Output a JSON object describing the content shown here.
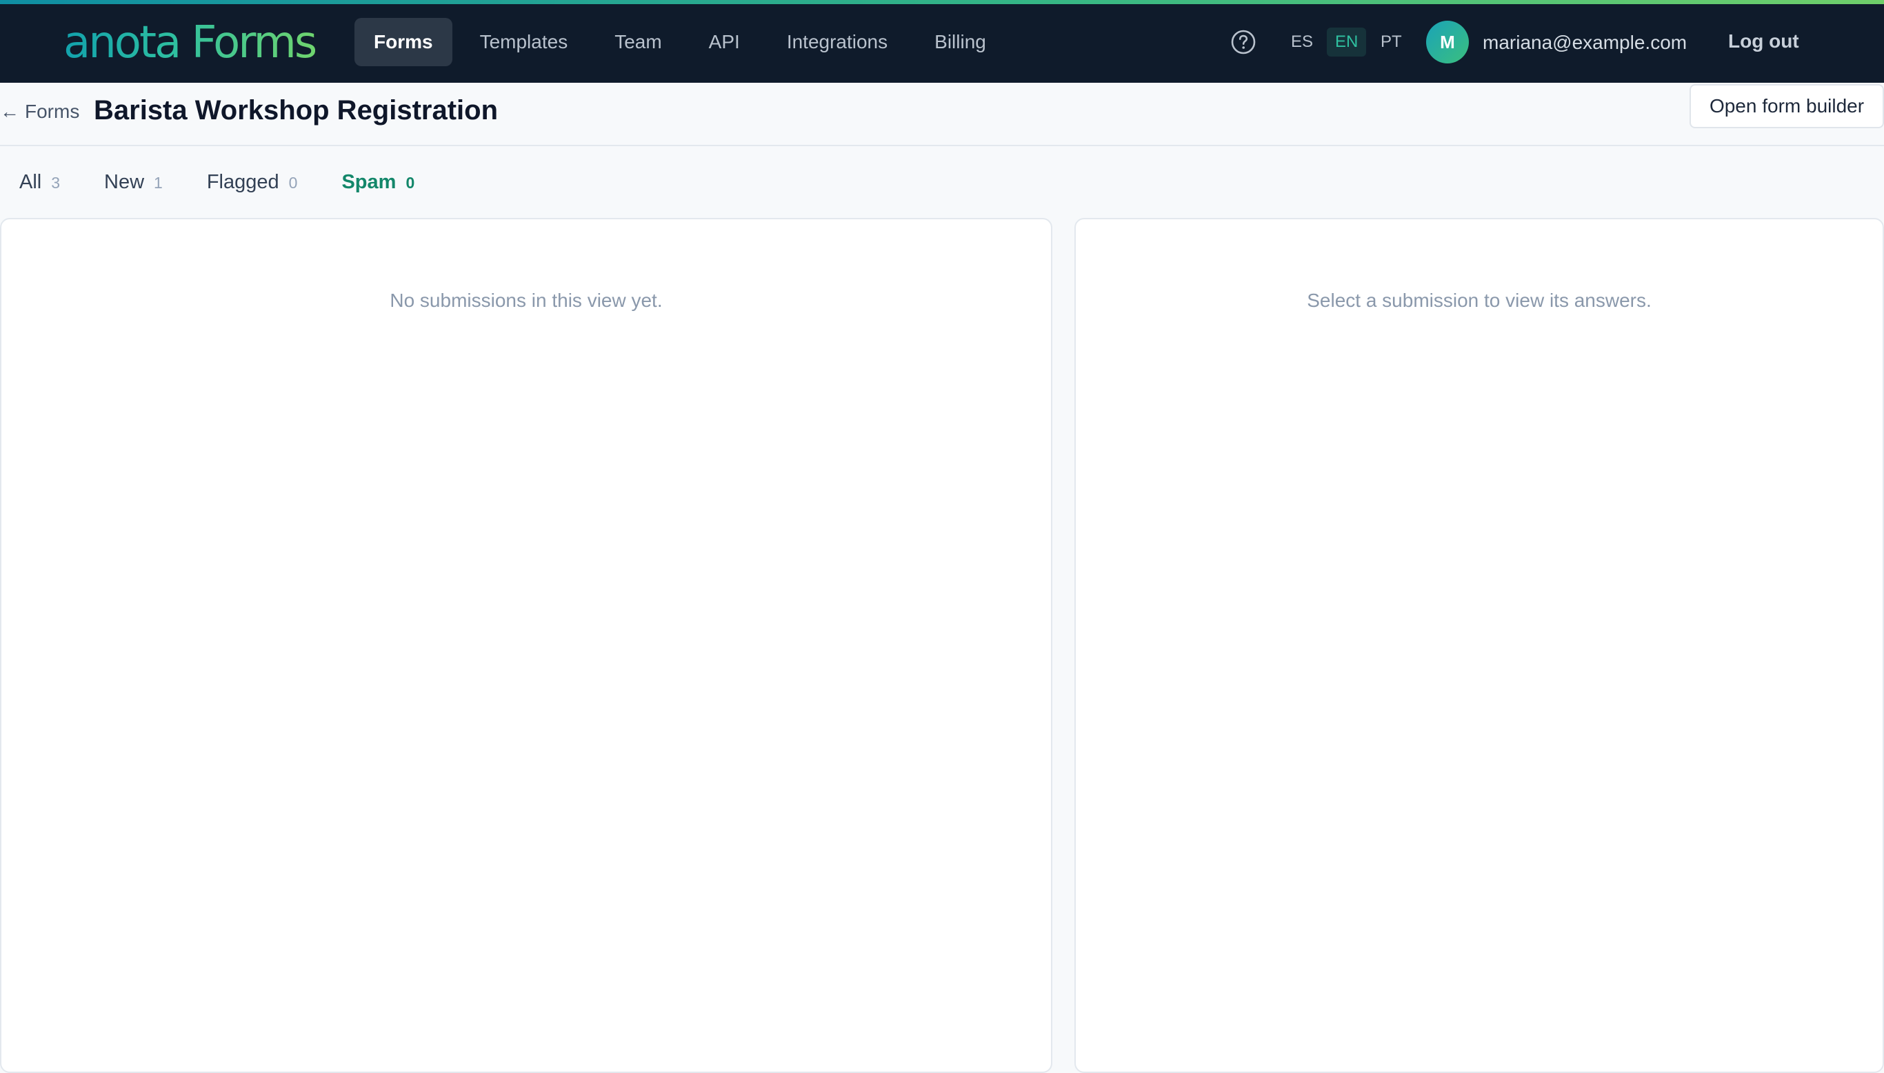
{
  "brand": {
    "logo_text": "anota Forms"
  },
  "nav": {
    "items": [
      {
        "label": "Forms",
        "active": true
      },
      {
        "label": "Templates",
        "active": false
      },
      {
        "label": "Team",
        "active": false
      },
      {
        "label": "API",
        "active": false
      },
      {
        "label": "Integrations",
        "active": false
      },
      {
        "label": "Billing",
        "active": false
      }
    ]
  },
  "header_actions": {
    "help_icon": "question-circle-icon",
    "languages": [
      {
        "code": "ES",
        "active": false
      },
      {
        "code": "EN",
        "active": true
      },
      {
        "code": "PT",
        "active": false
      }
    ],
    "avatar_initial": "M",
    "user_email": "mariana@example.com",
    "logout_label": "Log out"
  },
  "page": {
    "back_arrow": "←",
    "back_label": "Forms",
    "title": "Barista Workshop Registration",
    "builder_button": "Open form builder"
  },
  "tabs": [
    {
      "label": "All",
      "count": "3",
      "active": false
    },
    {
      "label": "New",
      "count": "1",
      "active": false
    },
    {
      "label": "Flagged",
      "count": "0",
      "active": false
    },
    {
      "label": "Spam",
      "count": "0",
      "active": true
    }
  ],
  "list_panel": {
    "empty_message": "No submissions in this view yet."
  },
  "detail_panel": {
    "empty_message": "Select a submission to view its answers."
  },
  "colors": {
    "topbar_bg": "#0f1b2b",
    "accent_green": "#13876a",
    "active_nav_bg": "#2c3847"
  }
}
